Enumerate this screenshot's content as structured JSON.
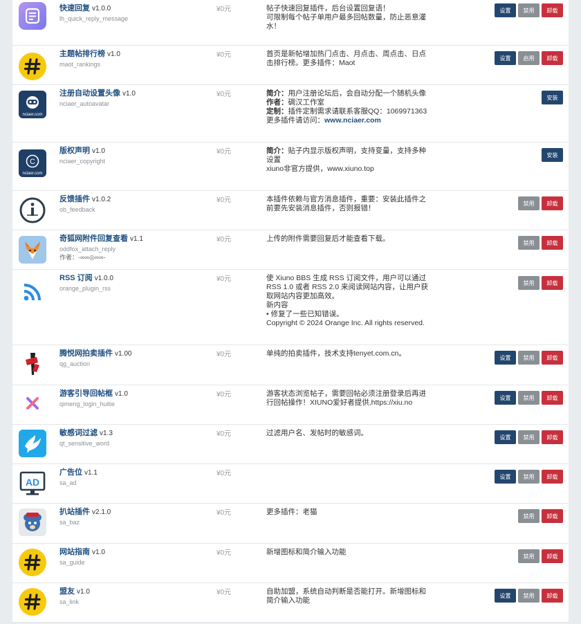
{
  "colors": {
    "link": "#1f4f80",
    "setting": "#23466e",
    "toggle": "#8a8f94",
    "uninstall": "#c8303d",
    "install": "#23466e"
  },
  "plugins": [
    {
      "name": "快速回复",
      "version": "v1.0.0",
      "slug": "lh_quick_reply_message",
      "price": "¥0元",
      "desc": [
        "帖子快速回复插件，后台设置回复语！",
        "可限制每个帖子单用户最多回帖数量，防止恶意灌",
        "水！"
      ],
      "buttons": [
        "设置",
        "禁用",
        "卸载"
      ],
      "icon": "quick-reply-icon"
    },
    {
      "name": "主题帖排行榜",
      "version": "v1.0",
      "slug": "maot_rankings",
      "price": "¥0元",
      "desc": [
        "首页是新帖增加热门点击、月点击、周点击、日点",
        "击排行榜。更多插件：Maot"
      ],
      "buttons": [
        "设置",
        "启用",
        "卸载"
      ],
      "icon": "hashtag-icon"
    },
    {
      "name": "注册自动设置头像",
      "version": "v1.0",
      "slug": "nciaer_autoavatar",
      "price": "¥0元",
      "desc_rich": [
        {
          "label": "简介：",
          "text": "用户注册论坛后，会自动分配一个随机头像"
        },
        {
          "label": "作者：",
          "text": "碉汉工作室"
        },
        {
          "label": "定制：",
          "text": "插件定制需求请联系客服QQ：1069971363"
        },
        {
          "label": "",
          "text": "更多插件请访问：",
          "link": "www.nciaer.com"
        }
      ],
      "buttons": [
        "安装"
      ],
      "icon": "nciaer-robot-icon",
      "icon_text": "nciaer.com"
    },
    {
      "name": "版权声明",
      "version": "v1.0",
      "slug": "nciaer_copyright",
      "price": "¥0元",
      "desc_rich": [
        {
          "label": "简介：",
          "text": "贴子内显示版权声明，支持变量，支持多种"
        },
        {
          "label": "",
          "text": "设置"
        },
        {
          "label": "",
          "text": "xiuno非官方提供，www.xiuno.top"
        }
      ],
      "buttons": [
        "安装"
      ],
      "icon": "copyright-icon",
      "icon_text": "nciaer.com"
    },
    {
      "name": "反馈插件",
      "version": "v1.0.2",
      "slug": "ob_feedback",
      "price": "¥0元",
      "desc": [
        "本插件依赖与官方消息插件，重要：安装此插件之",
        "前要先安装消息插件，否则报错！"
      ],
      "buttons": [
        "禁用",
        "卸载"
      ],
      "icon": "info-icon"
    },
    {
      "name": "奇狐网附件回复查看",
      "version": "v1.1",
      "slug": "oddfox_attach_reply",
      "price": "¥0元",
      "author": "作者：-∞∞◎∞∞-",
      "desc": [
        "上传的附件需要回复后才能查看下载。"
      ],
      "buttons": [
        "禁用",
        "卸载"
      ],
      "icon": "fox-icon"
    },
    {
      "name": "RSS 订阅",
      "version": "v1.0.0",
      "slug": "orange_plugin_rss",
      "price": "¥0元",
      "desc": [
        "使 Xiuno BBS 生成 RSS 订阅文件，用户可以通过",
        "RSS 1.0 或者 RSS 2.0 来阅读网站内容，让用户获",
        "取网站内容更加高效。",
        "新内容",
        "• 修复了一些已知错误。",
        "Copyright © 2024 Orange Inc. All rights reserved."
      ],
      "buttons": [
        "禁用",
        "卸载"
      ],
      "icon": "rss-icon"
    },
    {
      "name": "腾悦网拍卖插件",
      "version": "v1.00",
      "slug": "qg_auction",
      "price": "¥0元",
      "desc": [
        "单纯的拍卖插件，技术支持tenyet.com.cn。"
      ],
      "buttons": [
        "设置",
        "禁用",
        "卸载"
      ],
      "icon": "auction-icon"
    },
    {
      "name": "游客引导回帖框",
      "version": "v1.0",
      "slug": "qimeng_login_huitie",
      "price": "¥0元",
      "desc": [
        "游客状态浏览帖子，需要回帖必须注册登录后再进",
        "行回帖操作！XIUNO爱好者提供,https://xiu.no"
      ],
      "buttons": [
        "设置",
        "禁用",
        "卸载"
      ],
      "icon": "cross-icon"
    },
    {
      "name": "敏感词过滤",
      "version": "v1.3",
      "slug": "qt_sensitive_word",
      "price": "¥0元",
      "desc": [
        "过滤用户名、发帖时的敏感词。"
      ],
      "buttons": [
        "设置",
        "禁用",
        "卸载"
      ],
      "icon": "dove-icon"
    },
    {
      "name": "广告位",
      "version": "v1.1",
      "slug": "sa_ad",
      "price": "¥0元",
      "desc": [],
      "buttons": [
        "设置",
        "禁用",
        "卸载"
      ],
      "icon": "ad-monitor-icon",
      "icon_text": "AD"
    },
    {
      "name": "扒站插件",
      "version": "v2.1.0",
      "slug": "sa_baz",
      "price": "¥0元",
      "desc": [
        "更多插件：老猫"
      ],
      "buttons": [
        "禁用",
        "卸载"
      ],
      "icon": "bear-icon"
    },
    {
      "name": "网站指南",
      "version": "v1.0",
      "slug": "sa_guide",
      "price": "¥0元",
      "desc": [
        "新增图标和简介输入功能"
      ],
      "buttons": [
        "禁用",
        "卸载"
      ],
      "icon": "hashtag-icon"
    },
    {
      "name": "盟友",
      "version": "v1.0",
      "slug": "sa_link",
      "price": "¥0元",
      "desc": [
        "自助加盟，系统自动判断是否能打开。新增图标和",
        "简介输入功能"
      ],
      "buttons": [
        "设置",
        "禁用",
        "卸载"
      ],
      "icon": "hashtag-icon"
    }
  ]
}
